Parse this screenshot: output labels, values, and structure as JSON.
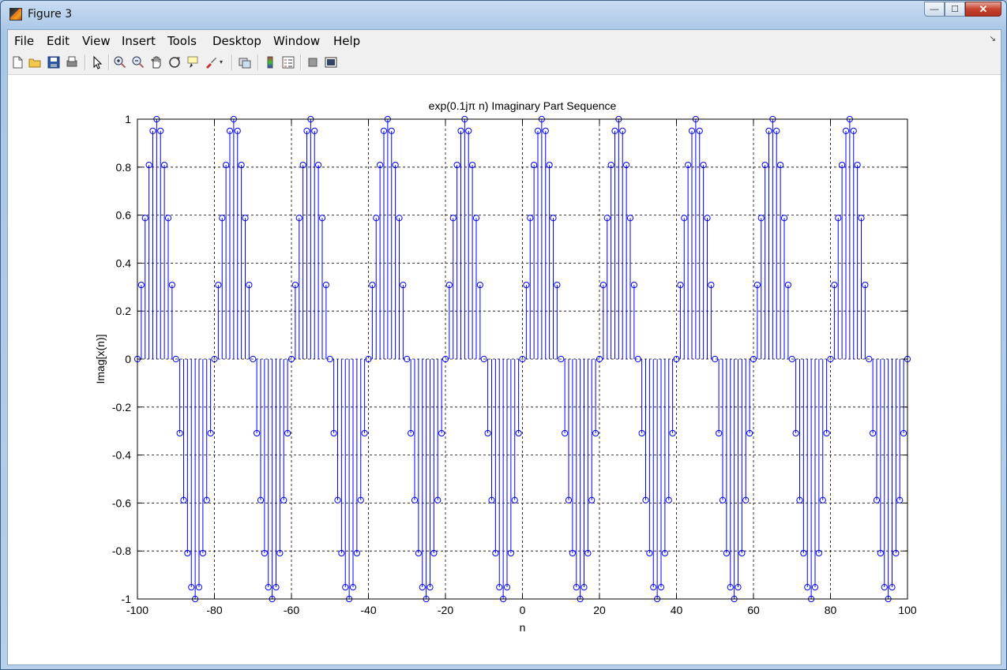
{
  "window": {
    "title": "Figure 3",
    "minimize": "—",
    "maximize": "☐",
    "close": "✕"
  },
  "menu": [
    "File",
    "Edit",
    "View",
    "Insert",
    "Tools",
    "Desktop",
    "Window",
    "Help"
  ],
  "toolbar": {
    "icons": [
      "new-figure-icon",
      "open-file-icon",
      "save-icon",
      "print-icon",
      "pointer-icon",
      "zoom-in-icon",
      "zoom-out-icon",
      "pan-icon",
      "rotate-3d-icon",
      "data-cursor-icon",
      "brush-icon",
      "link-icon",
      "colorbar-icon",
      "legend-icon",
      "hide-plot-tools-icon",
      "show-plot-tools-icon"
    ]
  },
  "colors": {
    "stem": "#0000ff",
    "axes": "#000000",
    "grid": "#000000"
  },
  "chart_data": {
    "type": "stem",
    "title": "exp(0.1jπ n) Imaginary Part Sequence",
    "xlabel": "n",
    "ylabel": "Imag[x(n)]",
    "xlim": [
      -100,
      100
    ],
    "ylim": [
      -1,
      1
    ],
    "xticks": [
      "-100",
      "-80",
      "-60",
      "-40",
      "-20",
      "0",
      "20",
      "40",
      "60",
      "80",
      "100"
    ],
    "yticks": [
      "-1",
      "-0.8",
      "-0.6",
      "-0.4",
      "-0.2",
      "0",
      "0.2",
      "0.4",
      "0.6",
      "0.8",
      "1"
    ],
    "grid": true,
    "marker": "circle",
    "x_range": {
      "start": -100,
      "end": 100,
      "step": 1
    },
    "values_period_20": [
      0,
      0.309,
      0.588,
      0.809,
      0.951,
      1,
      0.951,
      0.809,
      0.588,
      0.309,
      0,
      -0.309,
      -0.588,
      -0.809,
      -0.951,
      -1,
      -0.951,
      -0.809,
      -0.588,
      -0.309
    ]
  }
}
